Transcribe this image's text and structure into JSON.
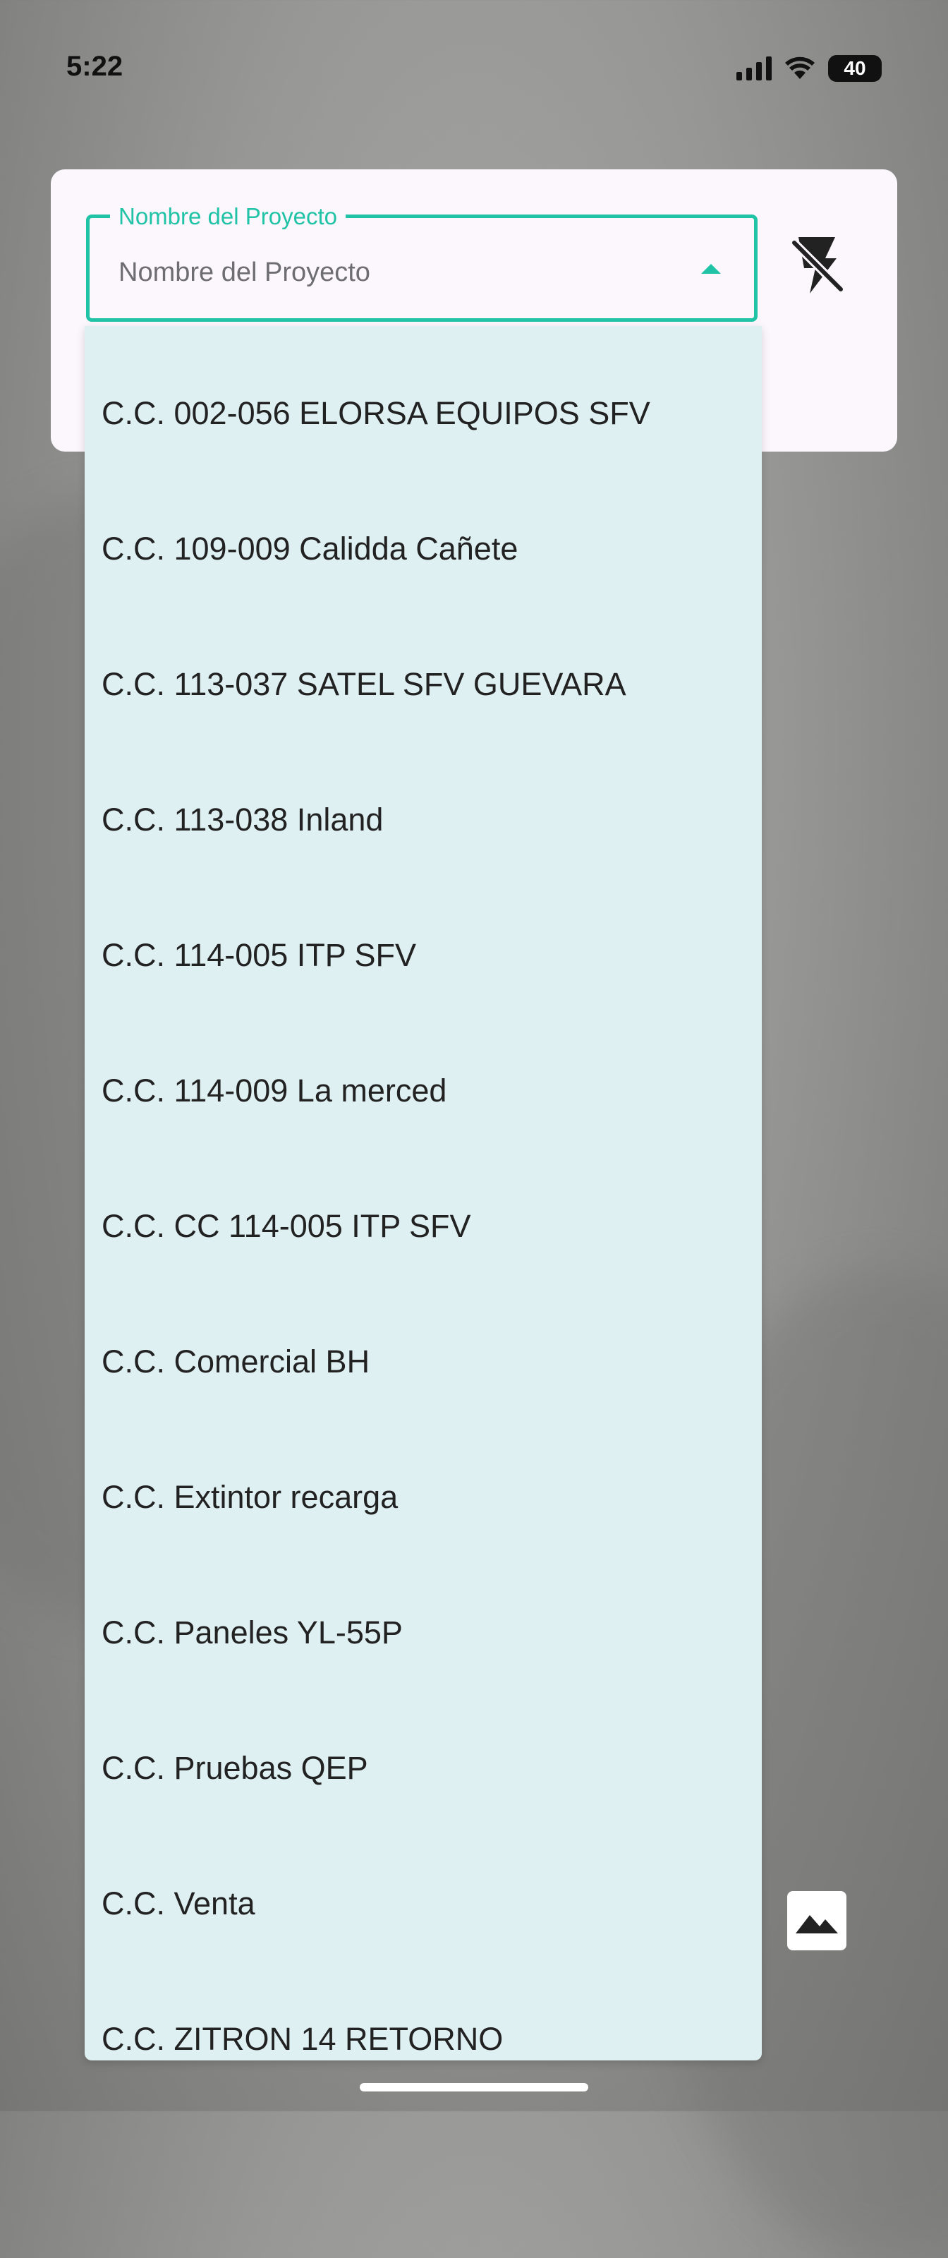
{
  "status_bar": {
    "time": "5:22",
    "battery": "40"
  },
  "project_field": {
    "label": "Nombre del Proyecto",
    "value": "Nombre del Proyecto"
  },
  "icons": {
    "flash": "flash-off-icon",
    "caret": "arrow-up-icon",
    "gallery": "image-icon"
  },
  "colors": {
    "accent": "#20c3a6",
    "dropdown_bg": "#dff0f3",
    "card_bg": "#fcf6fd"
  },
  "dropdown": {
    "items": [
      "C.C. 002-056 ELORSA EQUIPOS SFV",
      "C.C. 109-009 Calidda Cañete",
      "C.C. 113-037 SATEL SFV GUEVARA",
      "C.C. 113-038 Inland",
      "C.C. 114-005 ITP SFV",
      "C.C. 114-009 La merced",
      "C.C. CC 114-005 ITP SFV",
      "C.C. Comercial BH",
      "C.C. Extintor recarga",
      "C.C. Paneles YL-55P",
      "C.C. Pruebas QEP",
      "C.C. Venta",
      "C.C. ZITRON 14 RETORNO"
    ]
  }
}
